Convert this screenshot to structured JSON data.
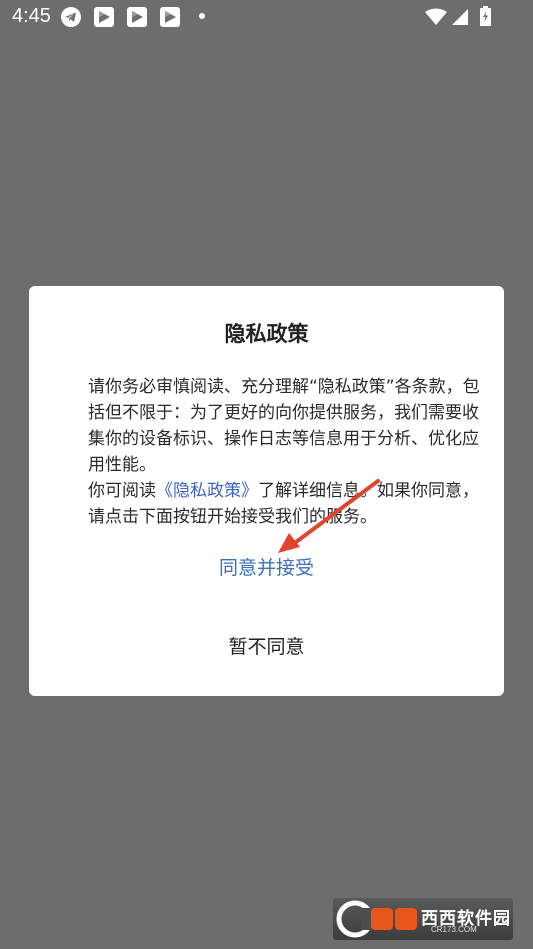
{
  "status_bar": {
    "time": "4:45",
    "icons": [
      "telegram-icon",
      "app-notification-icon",
      "app-notification-icon",
      "app-notification-icon",
      "more-dot-icon",
      "wifi-icon",
      "cell-signal-icon",
      "battery-charging-icon"
    ]
  },
  "dialog": {
    "title": "隐私政策",
    "paragraph1": "请你务必审慎阅读、充分理解“隐私政策”各条款，包括但不限于：为了更好的向你提供服务，我们需要收集你的设备标识、操作日志等信息用于分析、优化应用性能。",
    "paragraph2_before": "你可阅读",
    "policy_link": "《隐私政策》",
    "paragraph2_after": "了解详细信息。如果你同意，请点击下面按钮开始接受我们的服务。",
    "accept_label": "同意并接受",
    "decline_label": "暂不同意"
  },
  "watermark": {
    "name": "西西软件园",
    "url": "CR173.COM"
  },
  "colors": {
    "scrim": "#6d6d6d",
    "link": "#3c63c8",
    "accept": "#3c6fbc",
    "arrow": "#e0442c"
  }
}
